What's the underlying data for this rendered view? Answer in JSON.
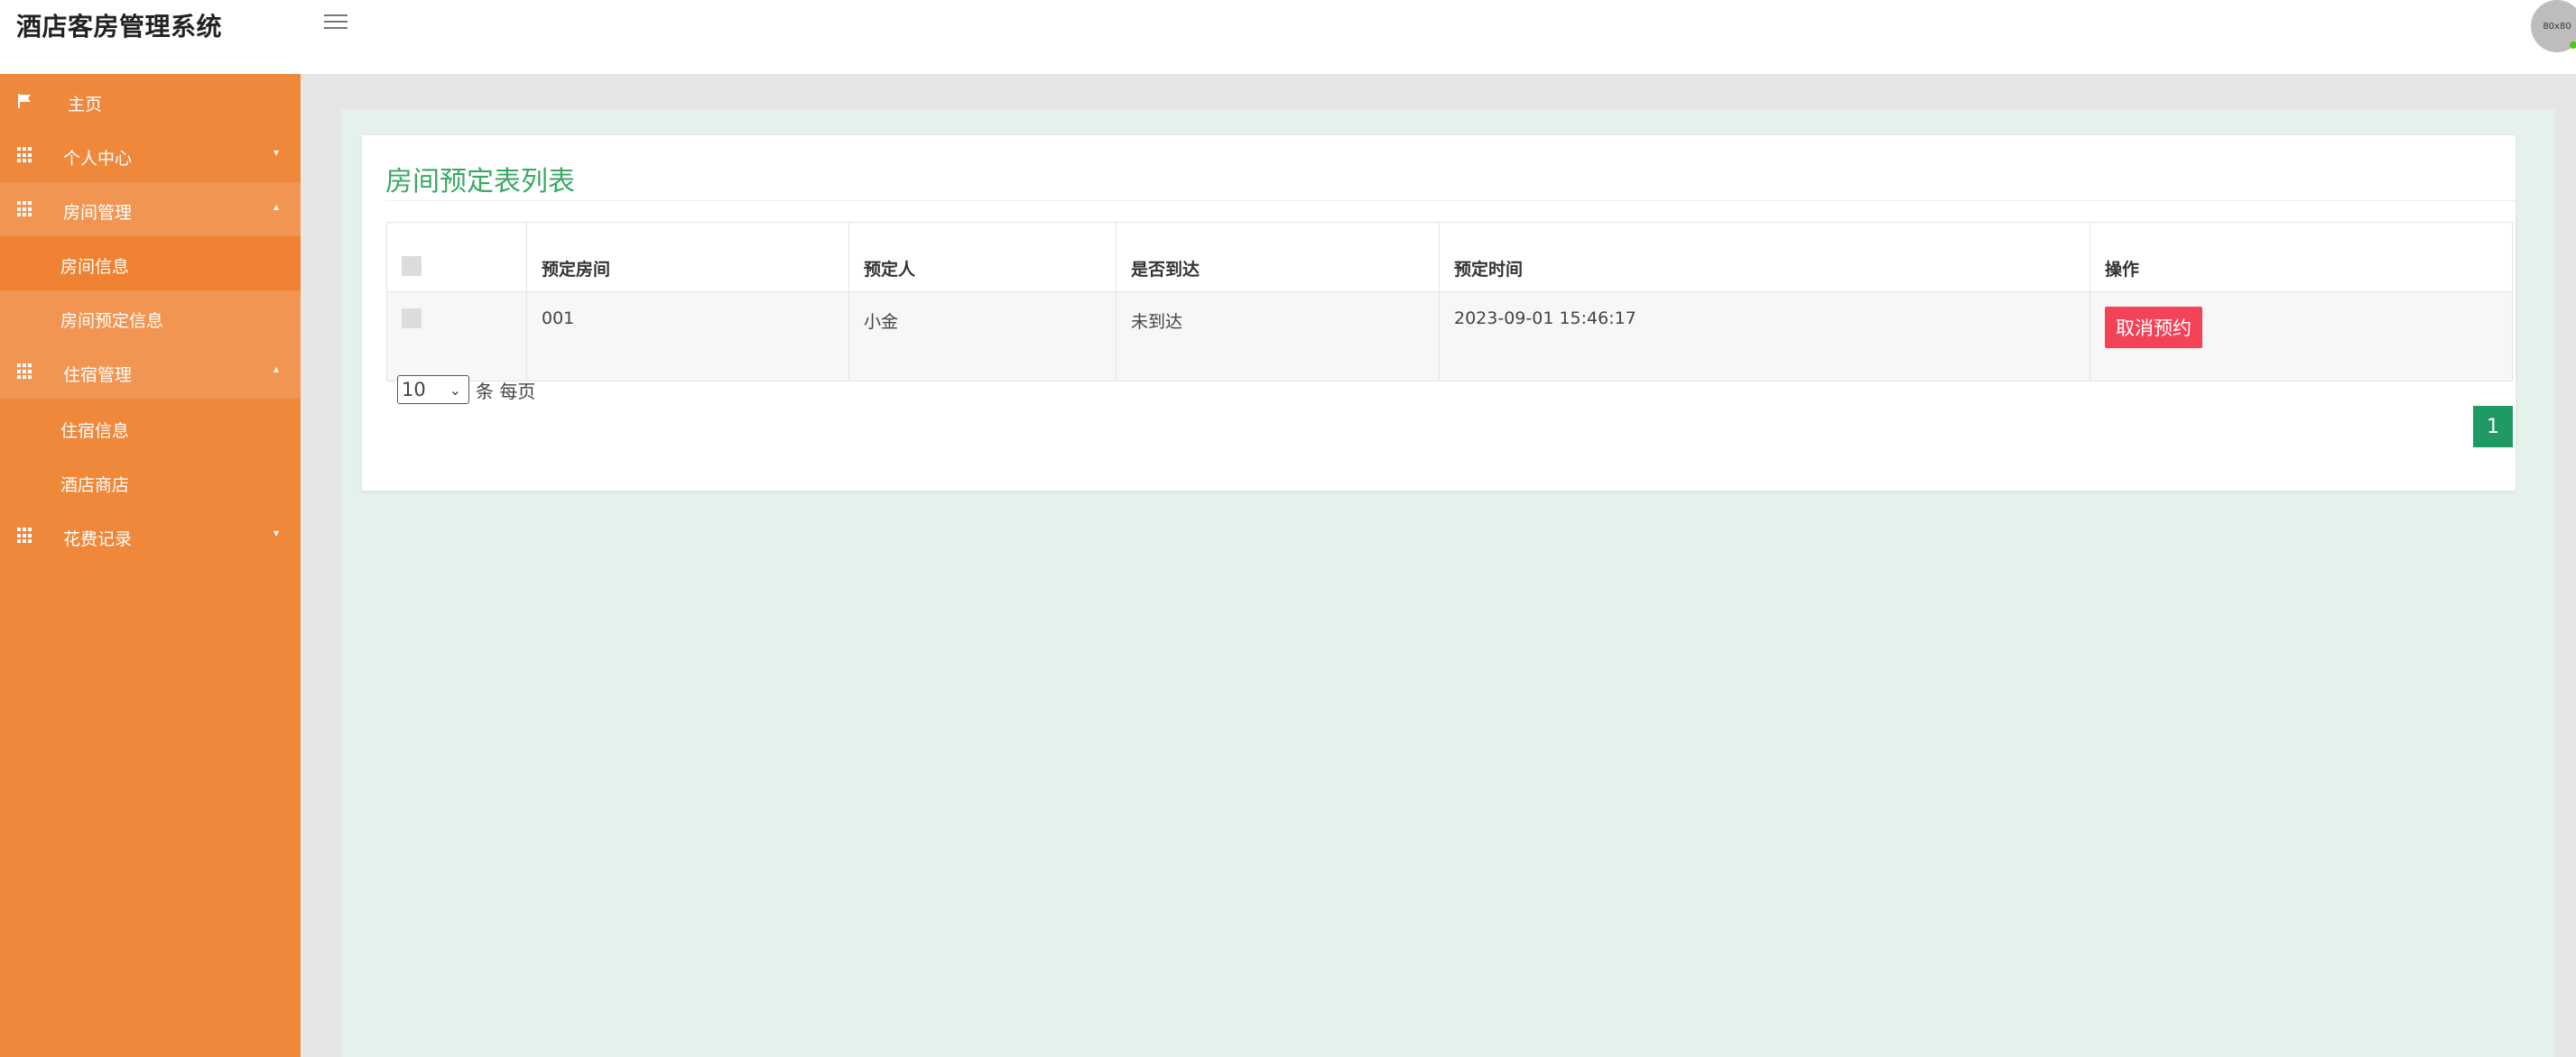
{
  "header": {
    "app_title": "酒店客房管理系统",
    "avatar_text": "80x80"
  },
  "sidebar": {
    "items": [
      {
        "label": "主页",
        "icon": "flag-icon"
      },
      {
        "label": "个人中心",
        "icon": "grid-icon"
      },
      {
        "label": "房间管理",
        "icon": "grid-icon"
      },
      {
        "label": "房间信息"
      },
      {
        "label": "房间预定信息"
      },
      {
        "label": "住宿管理",
        "icon": "grid-icon"
      },
      {
        "label": "住宿信息"
      },
      {
        "label": "酒店商店"
      },
      {
        "label": "花费记录",
        "icon": "grid-icon"
      }
    ]
  },
  "main": {
    "title": "房间预定表列表",
    "table": {
      "columns": [
        "预定房间",
        "预定人",
        "是否到达",
        "预定时间",
        "操作"
      ],
      "rows": [
        {
          "room": "001",
          "person": "小金",
          "arrived": "未到达",
          "time": "2023-09-01 15:46:17",
          "action": "取消预约"
        }
      ]
    },
    "pagination": {
      "per_page_value": "10",
      "per_page_label": "条 每页",
      "current_page": "1"
    }
  },
  "colors": {
    "sidebar": "#ef883b",
    "accent_green": "#3aa865",
    "danger": "#f44358",
    "page_button": "#1f9a64"
  }
}
